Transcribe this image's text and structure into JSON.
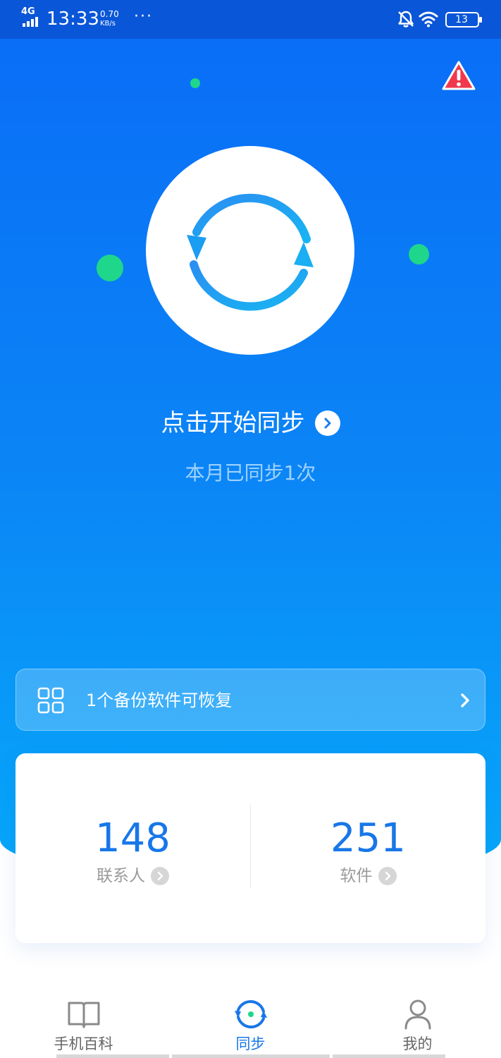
{
  "status_bar": {
    "network": "4G",
    "time": "13:33",
    "speed_value": "0.70",
    "speed_unit": "KB/s",
    "more": "···",
    "battery": "13"
  },
  "colors": {
    "accent": "#1877e8",
    "hero_top": "#0a6cf7",
    "hero_bottom": "#06a9fa",
    "green_dot": "#1ed78a",
    "warning": "#f0394c"
  },
  "hero": {
    "start_label": "点击开始同步",
    "sub_label": "本月已同步1次",
    "icon": "sync-icon"
  },
  "restore_banner": {
    "label": "1个备份软件可恢复",
    "icon": "apps-grid-icon"
  },
  "stats": {
    "contacts": {
      "value": "148",
      "label": "联系人"
    },
    "apps": {
      "value": "251",
      "label": "软件"
    }
  },
  "nav": {
    "items": [
      {
        "label": "手机百科",
        "icon": "book-icon",
        "active": false
      },
      {
        "label": "同步",
        "icon": "sync-icon",
        "active": true
      },
      {
        "label": "我的",
        "icon": "person-icon",
        "active": false
      }
    ]
  }
}
